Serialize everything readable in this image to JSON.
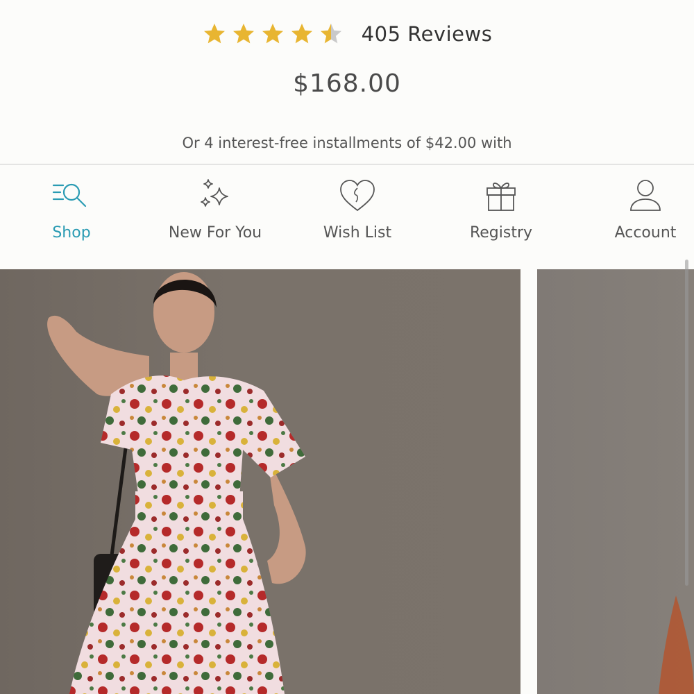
{
  "product": {
    "rating": 4.5,
    "rating_max": 5,
    "reviews_label": "405 Reviews",
    "price": "$168.00",
    "installments_text": "Or 4 interest-free installments of $42.00 with"
  },
  "colors": {
    "star_fill": "#e8b531",
    "star_empty": "#c9c9c9",
    "accent": "#2a9bb3"
  },
  "tab_bar": {
    "active": "shop",
    "tabs": [
      {
        "id": "shop",
        "label": "Shop",
        "icon": "search-list-icon"
      },
      {
        "id": "new",
        "label": "New For You",
        "icon": "sparkles-icon"
      },
      {
        "id": "wish",
        "label": "Wish List",
        "icon": "heart-icon"
      },
      {
        "id": "registry",
        "label": "Registry",
        "icon": "gift-icon"
      },
      {
        "id": "account",
        "label": "Account",
        "icon": "person-icon"
      }
    ]
  },
  "gallery": {
    "images": [
      {
        "name": "model-floral-dress-front"
      },
      {
        "name": "model-floral-dress-next"
      }
    ]
  }
}
